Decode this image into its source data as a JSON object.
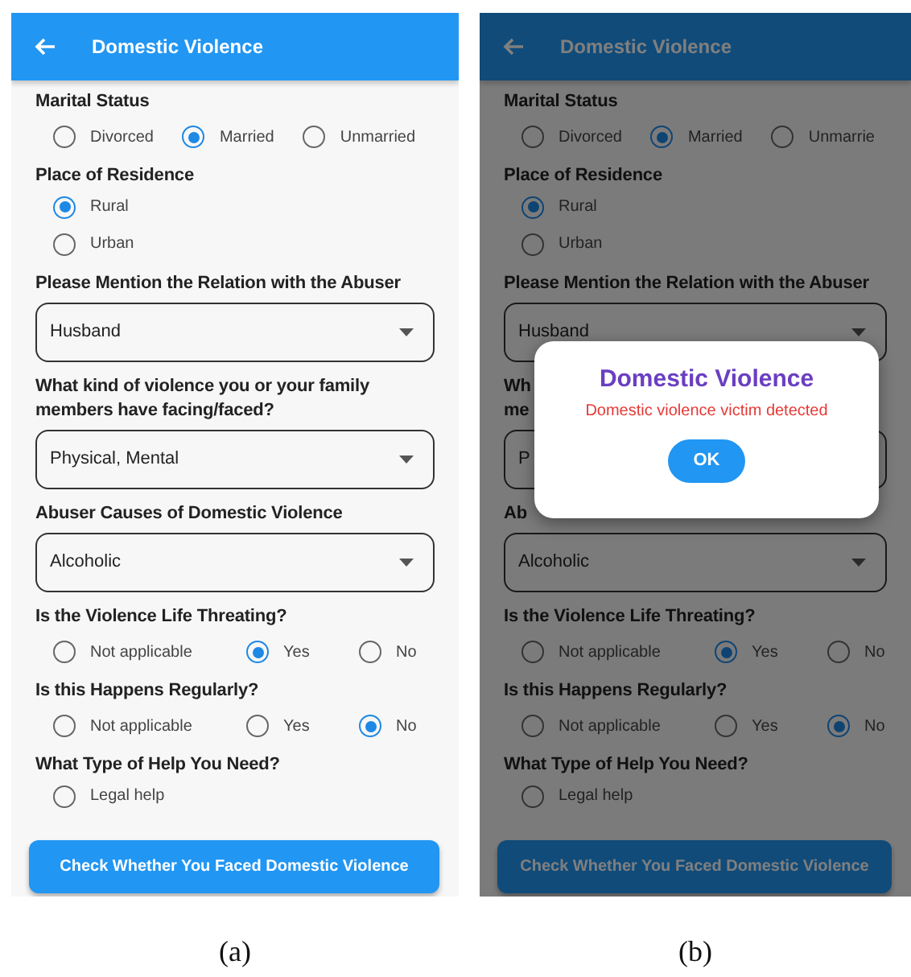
{
  "panels": [
    {
      "caption": "(a)",
      "screen": {
        "title": "Domestic Violence",
        "sections": [
          {
            "kind": "radio-row",
            "label": "Marital Status",
            "options": [
              {
                "label": "Divorced",
                "selected": false
              },
              {
                "label": "Married",
                "selected": true
              },
              {
                "label": "Unmarried",
                "selected": false
              }
            ]
          },
          {
            "kind": "radio-list",
            "label": "Place of Residence",
            "options": [
              {
                "label": "Rural",
                "selected": true
              },
              {
                "label": "Urban",
                "selected": false
              }
            ]
          },
          {
            "kind": "dropdown",
            "label": "Please Mention the Relation with the Abuser",
            "value": "Husband"
          },
          {
            "kind": "dropdown",
            "label": "What kind of violence you or your family\nmembers have facing/faced?",
            "value": "Physical, Mental"
          },
          {
            "kind": "dropdown",
            "label": "Abuser Causes of Domestic Violence",
            "value": "Alcoholic"
          },
          {
            "kind": "radio-row",
            "label": "Is the Violence Life Threating?",
            "options": [
              {
                "label": "Not applicable",
                "selected": false
              },
              {
                "label": "Yes",
                "selected": true
              },
              {
                "label": "No",
                "selected": false
              }
            ]
          },
          {
            "kind": "radio-row",
            "label": "Is this Happens Regularly?",
            "options": [
              {
                "label": "Not applicable",
                "selected": false
              },
              {
                "label": "Yes",
                "selected": false
              },
              {
                "label": "No",
                "selected": true
              }
            ]
          },
          {
            "kind": "radio-list",
            "label": "What Type of Help You Need?",
            "options": [
              {
                "label": "Legal help",
                "selected": false
              }
            ]
          }
        ],
        "submit": "Check Whether You Faced Domestic Violence"
      }
    },
    {
      "caption": "(b)",
      "screen": {
        "title": "Domestic Violence",
        "sections": [
          {
            "kind": "radio-row",
            "label": "Marital Status",
            "options": [
              {
                "label": "Divorced",
                "selected": false
              },
              {
                "label": "Married",
                "selected": true
              },
              {
                "label": "Unmarrie",
                "selected": false
              }
            ]
          },
          {
            "kind": "radio-list",
            "label": "Place of Residence",
            "options": [
              {
                "label": "Rural",
                "selected": true
              },
              {
                "label": "Urban",
                "selected": false
              }
            ]
          },
          {
            "kind": "dropdown",
            "label": "Please Mention the Relation with the Abuser",
            "value": "Husband"
          },
          {
            "kind": "dropdown",
            "label": "Wh\nme",
            "value": "P"
          },
          {
            "kind": "dropdown",
            "label": "Ab",
            "value": "Alcoholic"
          },
          {
            "kind": "radio-row",
            "label": "Is the Violence Life Threating?",
            "options": [
              {
                "label": "Not applicable",
                "selected": false
              },
              {
                "label": "Yes",
                "selected": true
              },
              {
                "label": "No",
                "selected": false
              }
            ]
          },
          {
            "kind": "radio-row",
            "label": "Is this Happens Regularly?",
            "options": [
              {
                "label": "Not applicable",
                "selected": false
              },
              {
                "label": "Yes",
                "selected": false
              },
              {
                "label": "No",
                "selected": true
              }
            ]
          },
          {
            "kind": "radio-list",
            "label": "What Type of Help You Need?",
            "options": [
              {
                "label": "Legal help",
                "selected": false
              }
            ]
          }
        ],
        "submit": "Check Whether You Faced Domestic Violence"
      },
      "dialog": {
        "title": "Domestic Violence",
        "message": "Domestic violence victim detected",
        "button": "OK"
      }
    }
  ]
}
